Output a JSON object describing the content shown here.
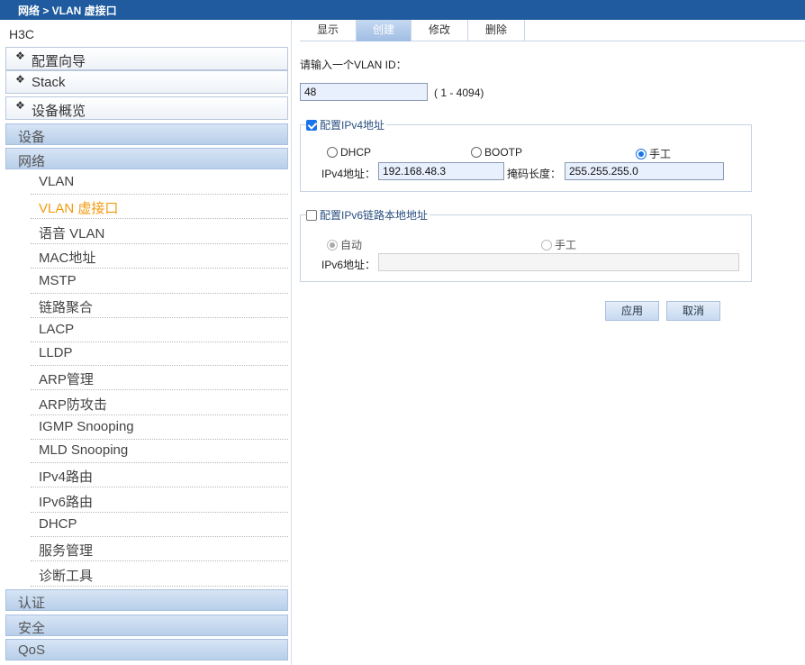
{
  "breadcrumb": "网络 > VLAN 虚接口",
  "brand": "H3C",
  "sidebar": {
    "boxes": [
      "配置向导",
      "Stack",
      "设备概览"
    ],
    "cats_top": [
      "设备",
      "网络"
    ],
    "net_items": [
      "VLAN",
      "VLAN 虚接口",
      "语音 VLAN",
      "MAC地址",
      "MSTP",
      "链路聚合",
      "LACP",
      "LLDP",
      "ARP管理",
      "ARP防攻击",
      "IGMP Snooping",
      "MLD Snooping",
      "IPv4路由",
      "IPv6路由",
      "DHCP",
      "服务管理",
      "诊断工具"
    ],
    "cats_bottom": [
      "认证",
      "安全",
      "QoS"
    ],
    "active": "VLAN 虚接口",
    "diamond_glyph": "❖"
  },
  "tabs": [
    "显示",
    "创建",
    "修改",
    "删除"
  ],
  "active_tab": "创建",
  "form": {
    "vlan_prompt": "请输入一个VLAN ID：",
    "vlan_value": "48",
    "vlan_range": "( 1 - 4094)",
    "ipv4": {
      "legend": "配置IPv4地址",
      "checked": true,
      "options": [
        "DHCP",
        "BOOTP",
        "手工"
      ],
      "selected": "手工",
      "addr_label": "IPv4地址：",
      "addr_value": "192.168.48.3",
      "mask_label": "掩码长度：",
      "mask_value": "255.255.255.0"
    },
    "ipv6": {
      "legend": "配置IPv6链路本地地址",
      "checked": false,
      "options": [
        "自动",
        "手工"
      ],
      "selected": "自动",
      "addr_label": "IPv6地址：",
      "addr_value": ""
    },
    "apply_label": "应用",
    "cancel_label": "取消"
  },
  "colors": {
    "topbar": "#1f5b9e",
    "active_nav": "#f39a0d",
    "accent": "#1a73e8"
  }
}
